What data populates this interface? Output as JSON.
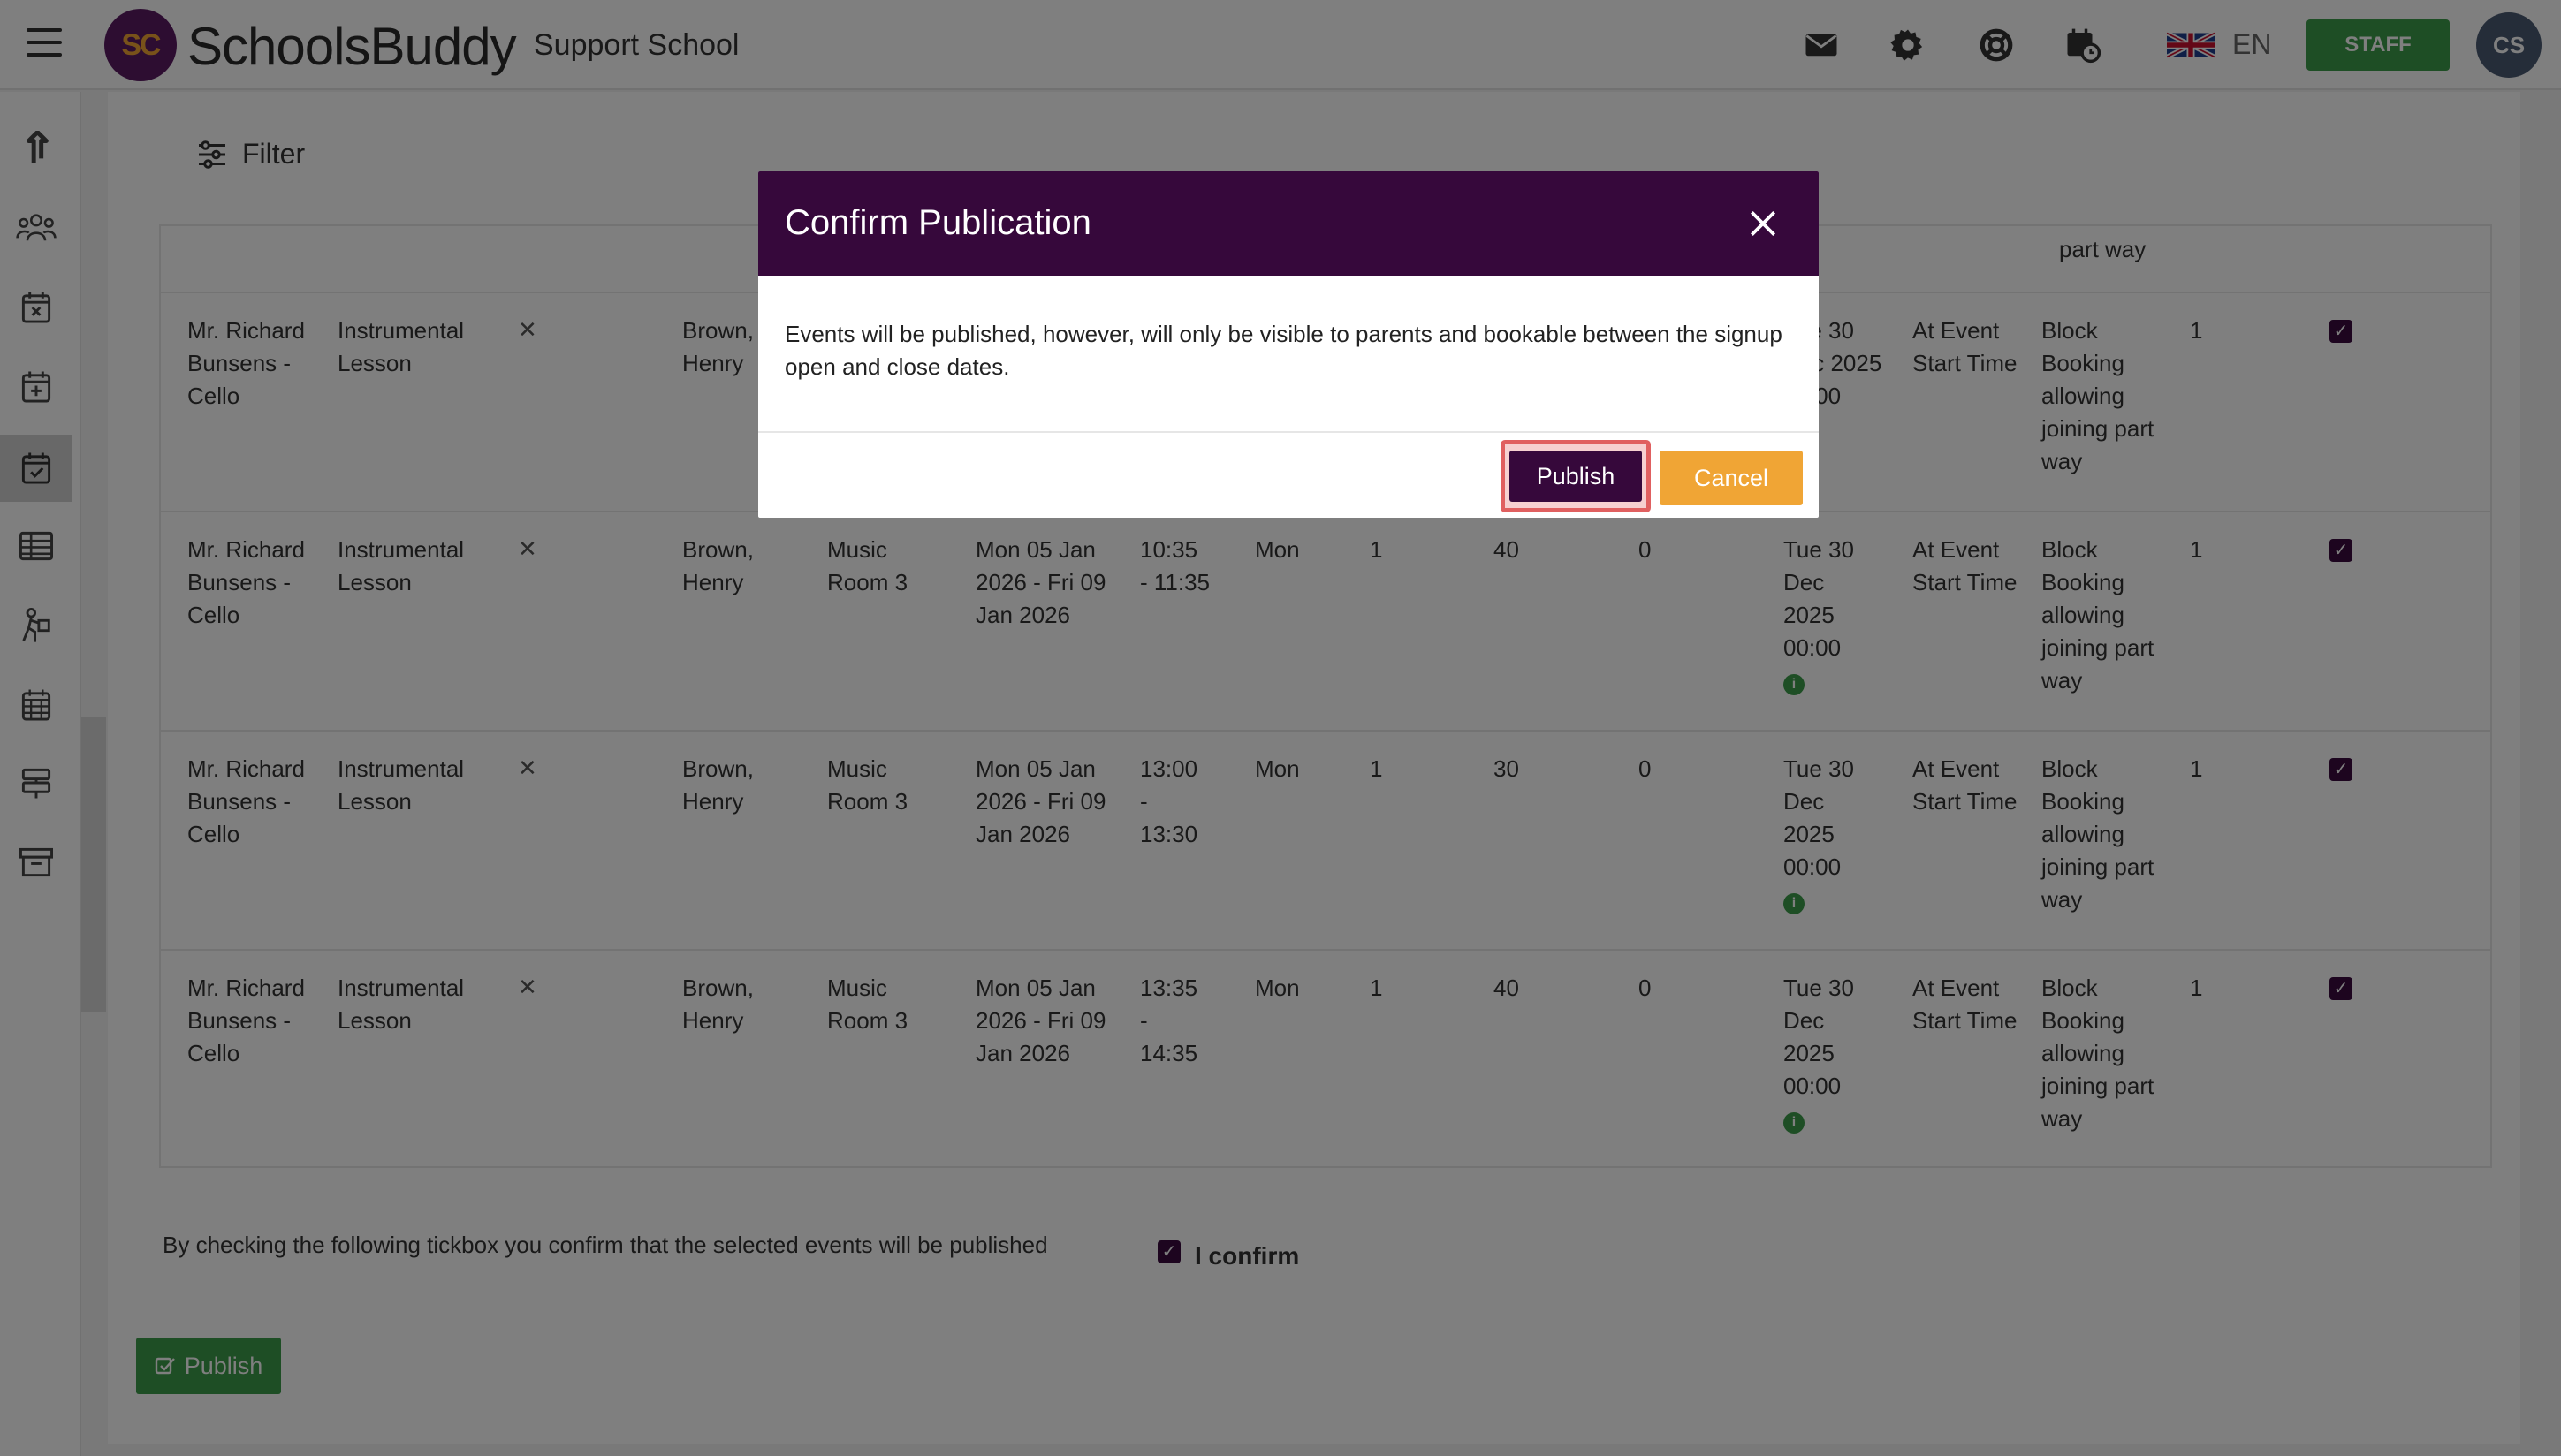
{
  "header": {
    "logo_initials": "SC",
    "app_name": "SchoolsBuddy",
    "school_name": "Support School",
    "language": "EN",
    "staff_label": "STAFF",
    "avatar_initials": "CS",
    "icons": [
      "envelope-icon",
      "gear-icon",
      "lifebuoy-icon",
      "calendar-clock-icon",
      "uk-flag-icon"
    ]
  },
  "sidebar": {
    "items": [
      "upload-icon",
      "people-icon",
      "calendar-x-icon",
      "calendar-plus-icon",
      "calendar-check-icon",
      "table-icon",
      "activity-icon",
      "calendar-grid-icon",
      "signpost-icon",
      "archive-icon"
    ],
    "active_index": 4
  },
  "main": {
    "filter_label": "Filter",
    "top_partial_text": "part way",
    "rows": [
      {
        "staff": "Mr. Richard Bunsens - Cello",
        "type": "Instrumental Lesson",
        "remove": "✕",
        "pupil": "Brown, Henry",
        "room": "",
        "dates": "",
        "time": "",
        "day": "",
        "c1": "",
        "c2": "",
        "c3": "",
        "signup": "Tue 30 Dec 2025 00:00",
        "close": "At Event Start Time",
        "booking": "Block Booking allowing joining part way",
        "qty": "1"
      },
      {
        "staff": "Mr. Richard Bunsens - Cello",
        "type": "Instrumental Lesson",
        "remove": "✕",
        "pupil": "Brown, Henry",
        "room": "Music Room 3",
        "dates": "Mon 05 Jan 2026 - Fri 09 Jan 2026",
        "time": "10:35 - 11:35",
        "day": "Mon",
        "c1": "1",
        "c2": "40",
        "c3": "0",
        "signup": "Tue 30 Dec 2025 00:00",
        "close": "At Event Start Time",
        "booking": "Block Booking allowing joining part way",
        "qty": "1"
      },
      {
        "staff": "Mr. Richard Bunsens - Cello",
        "type": "Instrumental Lesson",
        "remove": "✕",
        "pupil": "Brown, Henry",
        "room": "Music Room 3",
        "dates": "Mon 05 Jan 2026 - Fri 09 Jan 2026",
        "time": "13:00 - 13:30",
        "day": "Mon",
        "c1": "1",
        "c2": "30",
        "c3": "0",
        "signup": "Tue 30 Dec 2025 00:00",
        "close": "At Event Start Time",
        "booking": "Block Booking allowing joining part way",
        "qty": "1"
      },
      {
        "staff": "Mr. Richard Bunsens - Cello",
        "type": "Instrumental Lesson",
        "remove": "✕",
        "pupil": "Brown, Henry",
        "room": "Music Room 3",
        "dates": "Mon 05 Jan 2026 - Fri 09 Jan 2026",
        "time": "13:35 - 14:35",
        "day": "Mon",
        "c1": "1",
        "c2": "40",
        "c3": "0",
        "signup": "Tue 30 Dec 2025 00:00",
        "close": "At Event Start Time",
        "booking": "Block Booking allowing joining part way",
        "qty": "1"
      }
    ],
    "confirm_text": "By checking the following tickbox you confirm that the selected events will be published",
    "confirm_label": "I confirm",
    "publish_label": "Publish"
  },
  "modal": {
    "title": "Confirm Publication",
    "body": "Events will be published, however, will only be visible to parents and bookable between the signup open and close dates.",
    "publish_label": "Publish",
    "cancel_label": "Cancel"
  },
  "colors": {
    "brand_purple": "#36083b",
    "accent_orange": "#f0a535",
    "staff_green": "#3d9c4a",
    "highlight_red": "#e06060"
  }
}
